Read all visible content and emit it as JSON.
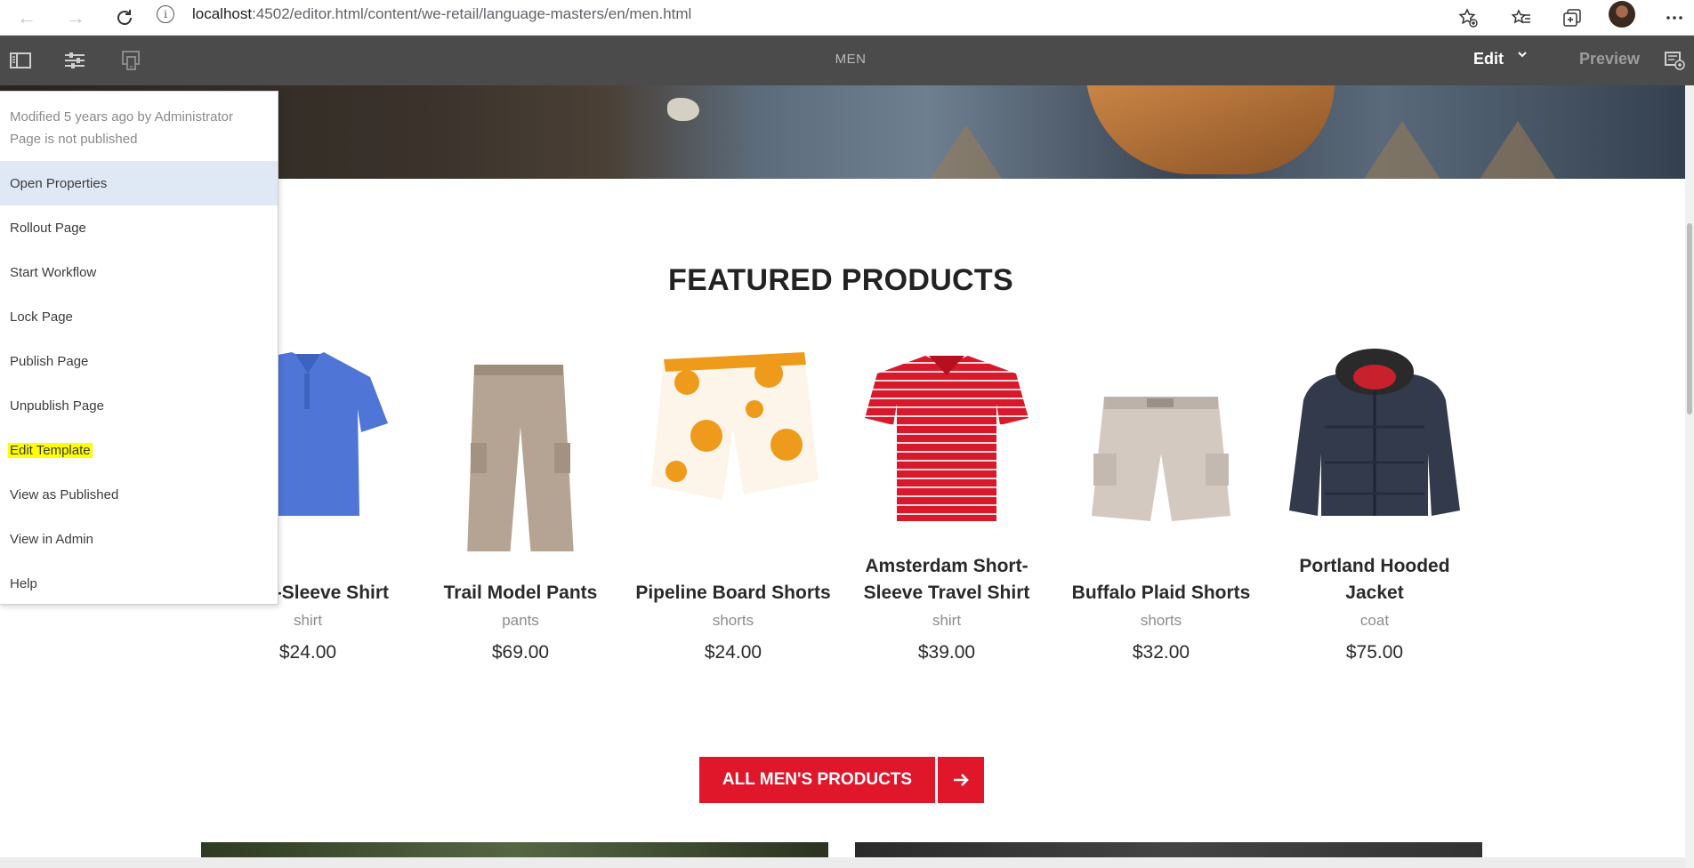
{
  "browser": {
    "url_host": "localhost",
    "url_path": ":4502/editor.html/content/we-retail/language-masters/en/men.html"
  },
  "editor": {
    "page_title": "MEN",
    "mode_label": "Edit",
    "preview_label": "Preview"
  },
  "page_info": {
    "modified": "Modified 5 years ago by Administrator",
    "status": "Page is not published",
    "items": [
      "Open Properties",
      "Rollout Page",
      "Start Workflow",
      "Lock Page",
      "Publish Page",
      "Unpublish Page",
      "Edit Template",
      "View as Published",
      "View in Admin",
      "Help"
    ]
  },
  "featured": {
    "title": "FEATURED PRODUCTS",
    "products": [
      {
        "name": "Short-Sleeve Shirt",
        "category": "shirt",
        "price": "$24.00"
      },
      {
        "name": "Trail Model Pants",
        "category": "pants",
        "price": "$69.00"
      },
      {
        "name": "Pipeline Board Shorts",
        "category": "shorts",
        "price": "$24.00"
      },
      {
        "name": "Amsterdam Short-Sleeve Travel Shirt",
        "category": "shirt",
        "price": "$39.00"
      },
      {
        "name": "Buffalo Plaid Shorts",
        "category": "shorts",
        "price": "$32.00"
      },
      {
        "name": "Portland Hooded Jacket",
        "category": "coat",
        "price": "$75.00"
      }
    ]
  },
  "cta": {
    "label": "ALL MEN'S PRODUCTS"
  },
  "colors": {
    "accent": "#e0162b",
    "editor_bar": "#4b4b4b",
    "highlight": "#ffff00"
  }
}
